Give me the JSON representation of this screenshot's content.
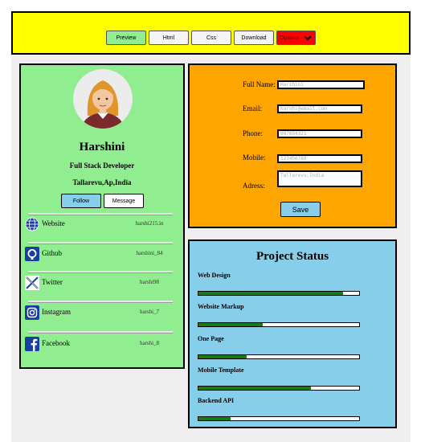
{
  "toolbar": {
    "preview": "Preview",
    "html": "Html",
    "css": "Css",
    "download": "Download",
    "options": "Options"
  },
  "profile": {
    "name": "Harshini",
    "role": "Full Stack Developer",
    "location": "Tallarevu,Ap,India",
    "follow": "Follow",
    "message": "Message",
    "links": [
      {
        "label": "Website",
        "value": "harshi215.in",
        "icon": "globe-icon"
      },
      {
        "label": "Github",
        "value": "harshini_84",
        "icon": "github-icon"
      },
      {
        "label": "Twitter",
        "value": "harshi98",
        "icon": "x-twitter-icon"
      },
      {
        "label": "Instagram",
        "value": "harshi_7",
        "icon": "instagram-icon"
      },
      {
        "label": "Facebook",
        "value": "harshi_8",
        "icon": "facebook-icon"
      }
    ]
  },
  "form": {
    "fullname_label": "Full Name:",
    "fullname_value": "Harshini",
    "email_label": "Email:",
    "email_value": "harshi@email.com",
    "phone_label": "Phone:",
    "phone_value": "987654321",
    "mobile_label": "Mobile:",
    "mobile_value": "123456789",
    "address_label": "Adress:",
    "address_value": "Tallarevu,India",
    "save": "Save"
  },
  "status": {
    "title": "Project Status",
    "projects": [
      {
        "label": "Web Design",
        "progress": 0.9
      },
      {
        "label": "Website Markup",
        "progress": 0.4
      },
      {
        "label": "One Page",
        "progress": 0.3
      },
      {
        "label": "Mobile Template",
        "progress": 0.7
      },
      {
        "label": "Backend API",
        "progress": 0.2
      }
    ]
  },
  "colors": {
    "toolbar": "#ffff00",
    "profile": "#90ee90",
    "form": "#ffa500",
    "status": "#87ceeb",
    "progress": "#1a7a1a"
  }
}
